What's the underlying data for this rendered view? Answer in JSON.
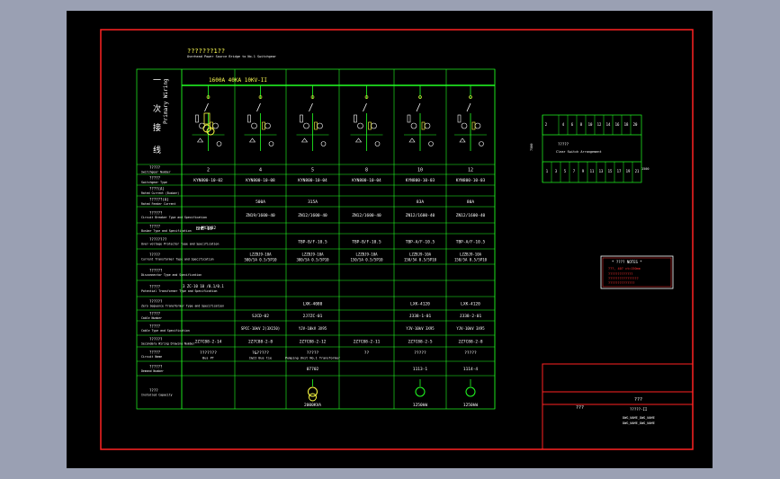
{
  "header": {
    "title_cn": "???????1??",
    "title_en": "Overhead Power Source Bridge to No.1 Switchgear",
    "busbar": "1600A 40KA 10KV-II"
  },
  "left_panel": {
    "cn_chars": [
      "一",
      "次",
      "接",
      "线"
    ],
    "en": "Primary Wiring"
  },
  "rows": [
    {
      "cn": "?????",
      "en": "Switchgear Number"
    },
    {
      "cn": "?????",
      "en": "Switchgear Type"
    },
    {
      "cn": "????(A)",
      "en": "Rated Current (Busbar)"
    },
    {
      "cn": "??????(A)",
      "en": "Rated Feeder Current"
    },
    {
      "cn": "??????",
      "en": "Circuit Breaker Type and Specification"
    },
    {
      "cn": "?????",
      "en": "Busbar Type and Specification"
    },
    {
      "cn": "????????",
      "en": "Over-voltage Protector Type and Specification"
    },
    {
      "cn": "?????",
      "en": "Current Transformer Type and Specification"
    },
    {
      "cn": "??????",
      "en": "Disconnector Type and Specification"
    },
    {
      "cn": "?????",
      "en": "Potential Transformer Type and Specification"
    },
    {
      "cn": "??????",
      "en": "Zero Sequence Transformer Type and Specification"
    },
    {
      "cn": "?????",
      "en": "Cable Number"
    },
    {
      "cn": "?????",
      "en": "Cable Type and Specification"
    },
    {
      "cn": "??????",
      "en": "Secondary Wiring Drawing Number"
    },
    {
      "cn": "?????",
      "en": "Circuit Name"
    },
    {
      "cn": "??????",
      "en": "Demand Number"
    },
    {
      "cn": "????",
      "en": "Installed Capacity"
    }
  ],
  "row_extra": {
    "bus_cell": "BHE-10",
    "pt_cell": "3 ZC-10 10 /0.1/0.1"
  },
  "columns": [
    {
      "number": "2",
      "type": "KYN800-10-02",
      "rated": "",
      "cb": "",
      "busbar": "MY3X82",
      "ovp": "",
      "ct": "",
      "dis": "",
      "cable_no": "",
      "cable_type": "",
      "drawing": "2Z7C88-2-14",
      "circuit": "???????",
      "circuit2": "Bus PT",
      "demand": "",
      "capacity": ""
    },
    {
      "number": "4",
      "type": "KYN800-10-08",
      "rated": "500A",
      "cb": "ZN19/1600-40",
      "busbar": "",
      "ovp": "",
      "ct": "LZZBJ9-10A",
      "ct2": "500/5A 0.5/5P10",
      "dis": "",
      "cable_no": "SJCD-02",
      "cable_type": "SPCC-10kV 2(3X150)",
      "drawing": "2Z7C88-2-8",
      "circuit": "?&?????",
      "circuit2": "I&II Bus tie",
      "demand": "",
      "capacity": ""
    },
    {
      "number": "5",
      "type": "KYN800-10-04",
      "rated": "315A",
      "cb": "ZN12/1600-40",
      "busbar": "",
      "ovp": "TBP-B/F-10.5",
      "ct": "LZZBJ9-10A",
      "ct2": "300/5A 0.5/5P10",
      "dis": "LXK-4080",
      "cable_no": "2J7ZC-01",
      "cable_type": "YJV-10kV 3X95",
      "drawing": "2Z7C88-2-12",
      "circuit": "?????",
      "circuit2": "Pumping Unit No.1 Transformer",
      "demand": "07702",
      "capacity": "2000KVA"
    },
    {
      "number": "8",
      "type": "KYN800-10-04",
      "rated": "",
      "cb": "ZN12/1600-40",
      "busbar": "",
      "ovp": "TBP-B/F-10.5",
      "ct": "LZZBJ9-10A",
      "ct2": "150/5A 0.5/5P10",
      "dis": "",
      "cable_no": "",
      "cable_type": "",
      "drawing": "2Z7C88-2-11",
      "circuit": "??",
      "circuit2": "",
      "demand": "",
      "capacity": ""
    },
    {
      "number": "10",
      "type": "KYN800-10-03",
      "rated": "83A",
      "cb": "ZN12/1600-40",
      "busbar": "",
      "ovp": "TBP-A/F-10.5",
      "ct": "LZZBJ9-10A",
      "ct2": "150/5A 0.5/5P10",
      "dis": "LXK-4120",
      "cable_no": "J338-1-01",
      "cable_type": "YJV-10kV 3X95",
      "drawing": "2Z7C88-2-5",
      "circuit": "?????",
      "circuit2": "",
      "demand": "1113-1",
      "capacity": "1250kW"
    },
    {
      "number": "12",
      "type": "KYN800-10-03",
      "rated": "80A",
      "cb": "ZN12/1600-40",
      "busbar": "",
      "ovp": "TBP-A/F-10.5",
      "ct": "LZZBJ9-10A",
      "ct2": "150/5A 0.5/5P10",
      "dis": "LXK-4120",
      "cable_no": "J338-2-01",
      "cable_type": "YJV-10kV 3X95",
      "drawing": "2Z7C88-2-8",
      "circuit": "?????",
      "circuit2": "",
      "demand": "1114-4",
      "capacity": "1250kW"
    }
  ],
  "mini_layout": {
    "top": [
      "2",
      "4",
      "6",
      "8",
      "10",
      "12",
      "14",
      "16",
      "18",
      "20"
    ],
    "bottom": [
      "1",
      "3",
      "5",
      "7",
      "9",
      "11",
      "13",
      "15",
      "17",
      "19",
      "21"
    ],
    "label_cn": "?????",
    "label_en": "Clear Switch Arrangement",
    "dim_left": "7500",
    "dim_right": "1500"
  },
  "note": {
    "title": "* ???? NOTES *",
    "line1": "???, 40? ct=150mm",
    "line2": "?????????????",
    "line3": "????????????????",
    "line4": "??????????????"
  },
  "title_block": {
    "code": "???",
    "title1": "???",
    "title2": "?????-II",
    "line3": "DWG_NAME_DWG_NAME",
    "line4": "DWG_NAME_DWG_NAME"
  },
  "colors": {
    "frame": "#ff2222",
    "line": "#22ff22",
    "text": "#ffffff",
    "accent": "#ffff44"
  }
}
